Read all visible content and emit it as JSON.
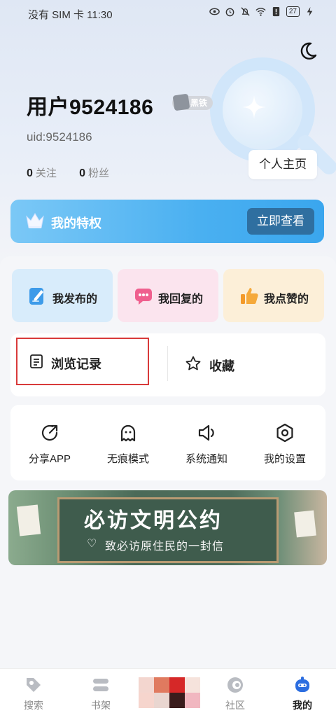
{
  "status_bar": {
    "left": "没有 SIM 卡 11:30",
    "battery": "27"
  },
  "profile": {
    "username": "用户9524186",
    "level": "黑铁",
    "uid": "uid:9524186",
    "following_count": "0",
    "following_label": "关注",
    "followers_count": "0",
    "followers_label": "粉丝",
    "home_button": "个人主页"
  },
  "privilege": {
    "title": "我的特权",
    "button": "立即查看"
  },
  "quick_actions": [
    {
      "label": "我发布的",
      "icon": "edit-icon"
    },
    {
      "label": "我回复的",
      "icon": "comment-icon"
    },
    {
      "label": "我点赞的",
      "icon": "thumbs-up-icon"
    }
  ],
  "history": {
    "label": "浏览记录",
    "icon": "document-icon"
  },
  "favorites": {
    "label": "收藏",
    "icon": "star-icon"
  },
  "tools": [
    {
      "label": "分享APP",
      "icon": "share-icon"
    },
    {
      "label": "无痕模式",
      "icon": "ghost-icon"
    },
    {
      "label": "系统通知",
      "icon": "speaker-icon"
    },
    {
      "label": "我的设置",
      "icon": "settings-icon"
    }
  ],
  "banner": {
    "title": "必访文明公约",
    "subtitle": "致必访原住民的一封信"
  },
  "tabbar": [
    {
      "label": "搜索",
      "icon": "search-tag-icon"
    },
    {
      "label": "书架",
      "icon": "bookshelf-icon"
    },
    {
      "label": "社区",
      "icon": "community-icon"
    },
    {
      "label": "我的",
      "icon": "profile-robot-icon",
      "active": true
    }
  ],
  "colors": {
    "accent_blue": "#3aa6ee",
    "highlight_red": "#d83a3a",
    "active_tab": "#2b6de0"
  }
}
